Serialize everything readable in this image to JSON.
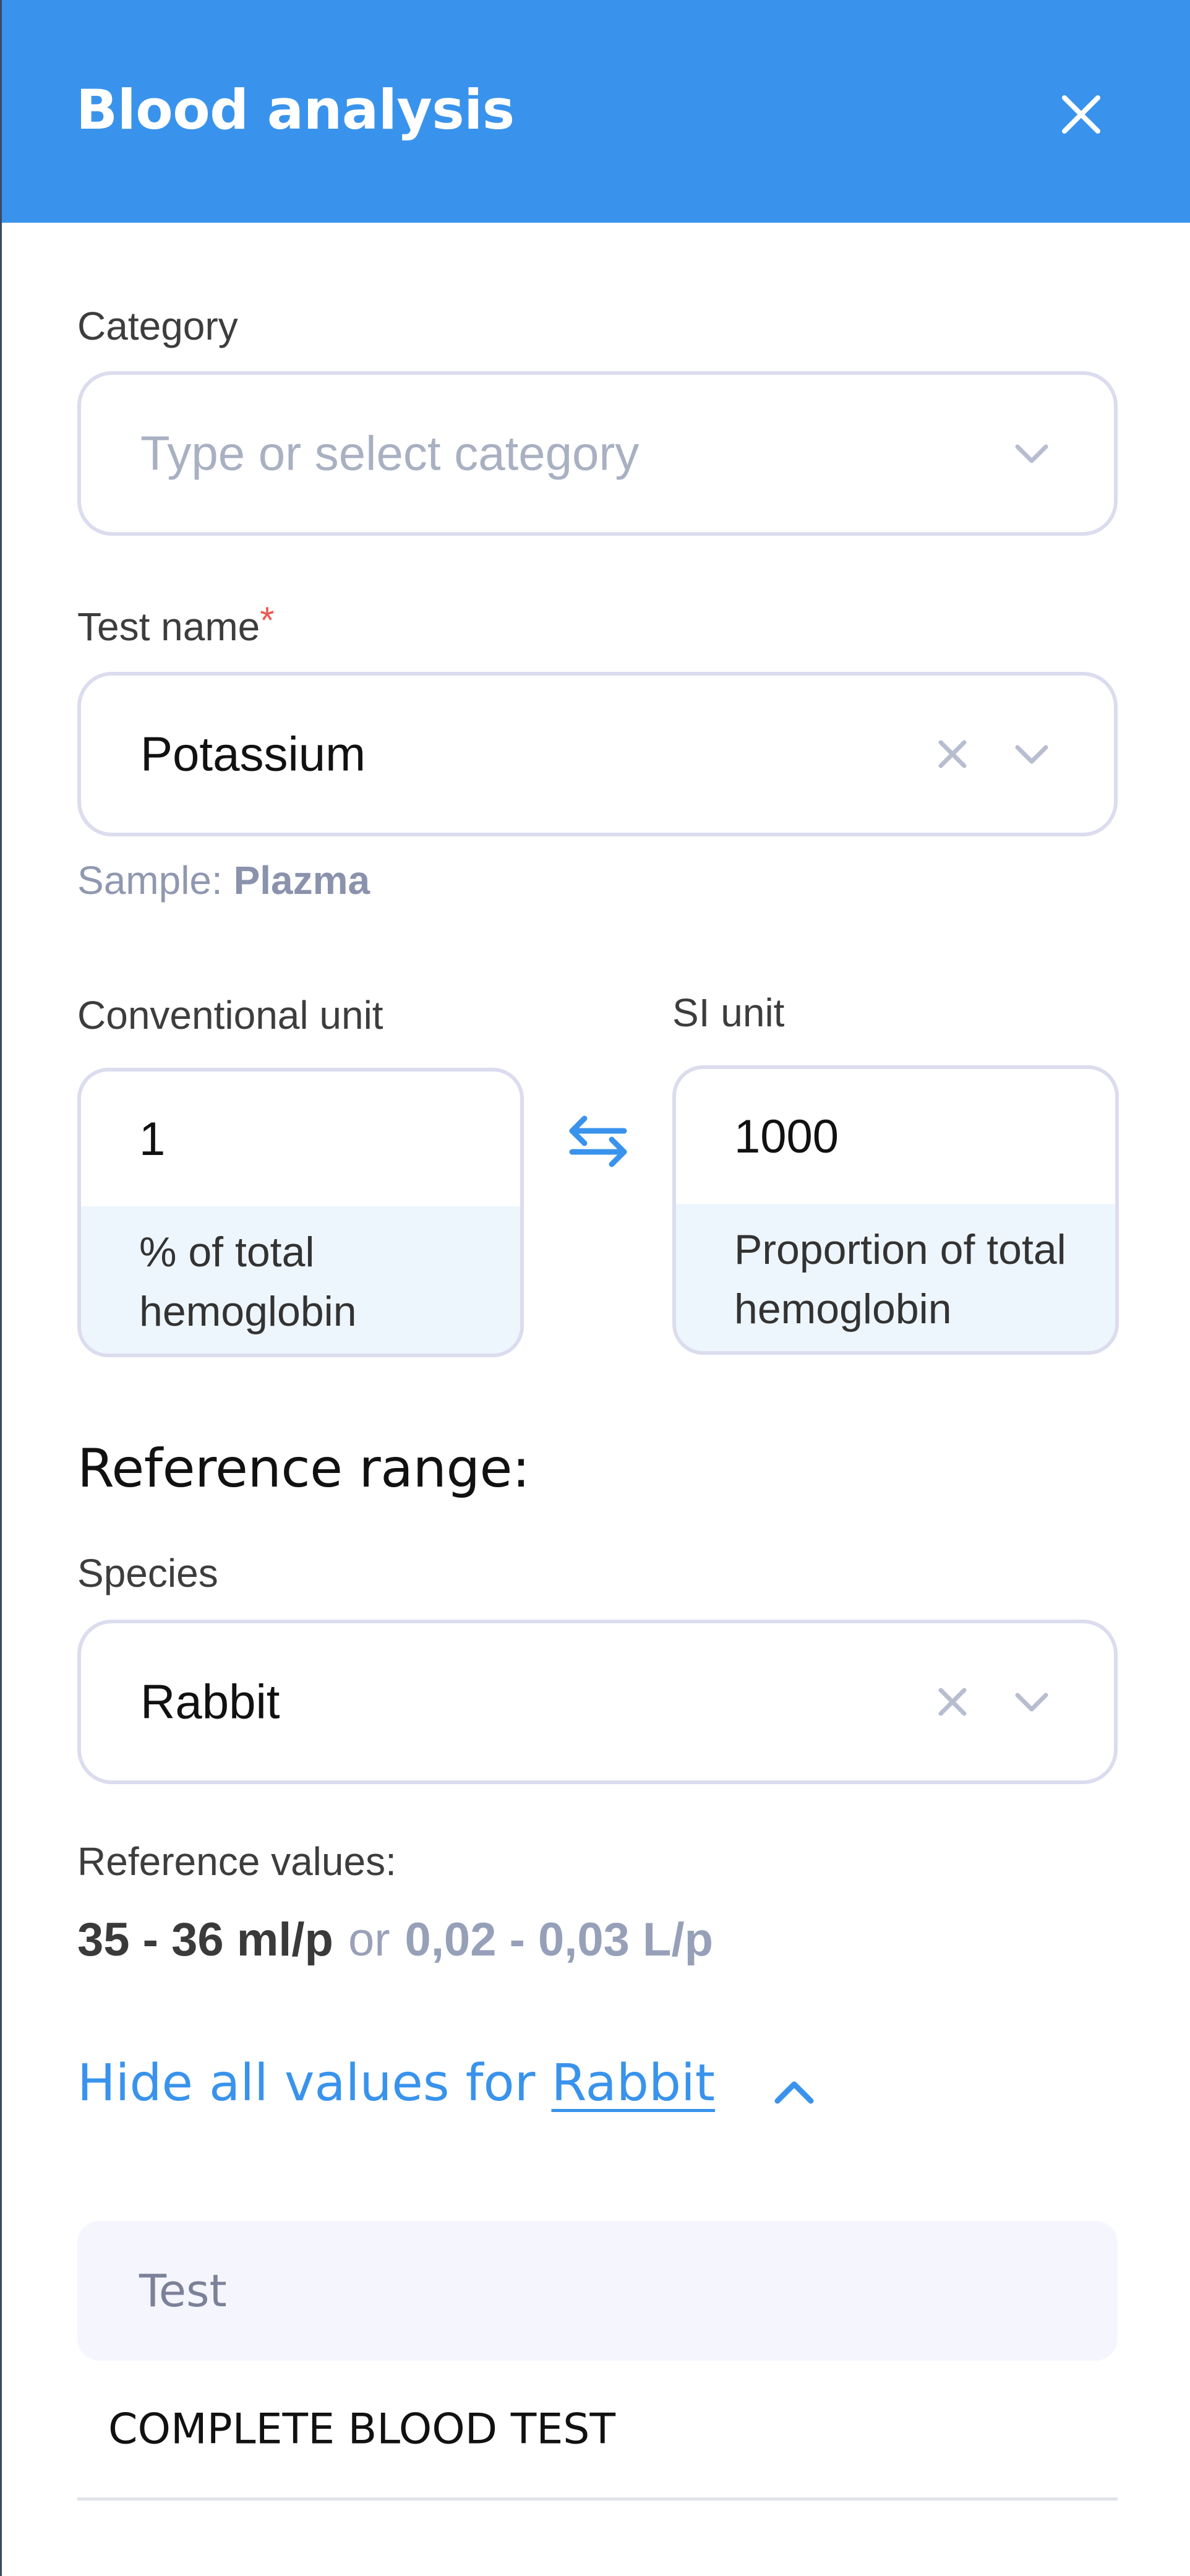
{
  "header": {
    "title": "Blood analysis",
    "close_icon": "close-icon"
  },
  "category": {
    "label": "Category",
    "placeholder": "Type or select category",
    "value": ""
  },
  "test_name": {
    "label": "Test name",
    "required_mark": "*",
    "value": "Potassium"
  },
  "sample": {
    "prefix": "Sample:",
    "value": "Plazma"
  },
  "units": {
    "conventional": {
      "label": "Conventional unit",
      "value": "1",
      "unit_name": "% of total hemoglobin"
    },
    "si": {
      "label": "SI unit",
      "value": "1000",
      "unit_name": "Proportion of total hemoglobin"
    },
    "swap_icon": "swap-arrows-icon"
  },
  "reference": {
    "title": "Reference range:",
    "species_label": "Species",
    "species_value": "Rabbit",
    "values_label": "Reference values:",
    "conventional_range": "35 - 36 ml/p",
    "or_text": "or",
    "si_range": "0,02 - 0,03 L/p",
    "toggle_prefix": "Hide all values for",
    "toggle_species": "Rabbit"
  },
  "table": {
    "header": "Test",
    "rows": [
      "COMPLETE BLOOD TEST"
    ]
  },
  "colors": {
    "accent": "#3993ec",
    "required": "#e95b4f",
    "field_border": "#dcdcef",
    "unit_caption_bg": "#eef6fd",
    "table_header_bg": "#f5f5fd"
  }
}
